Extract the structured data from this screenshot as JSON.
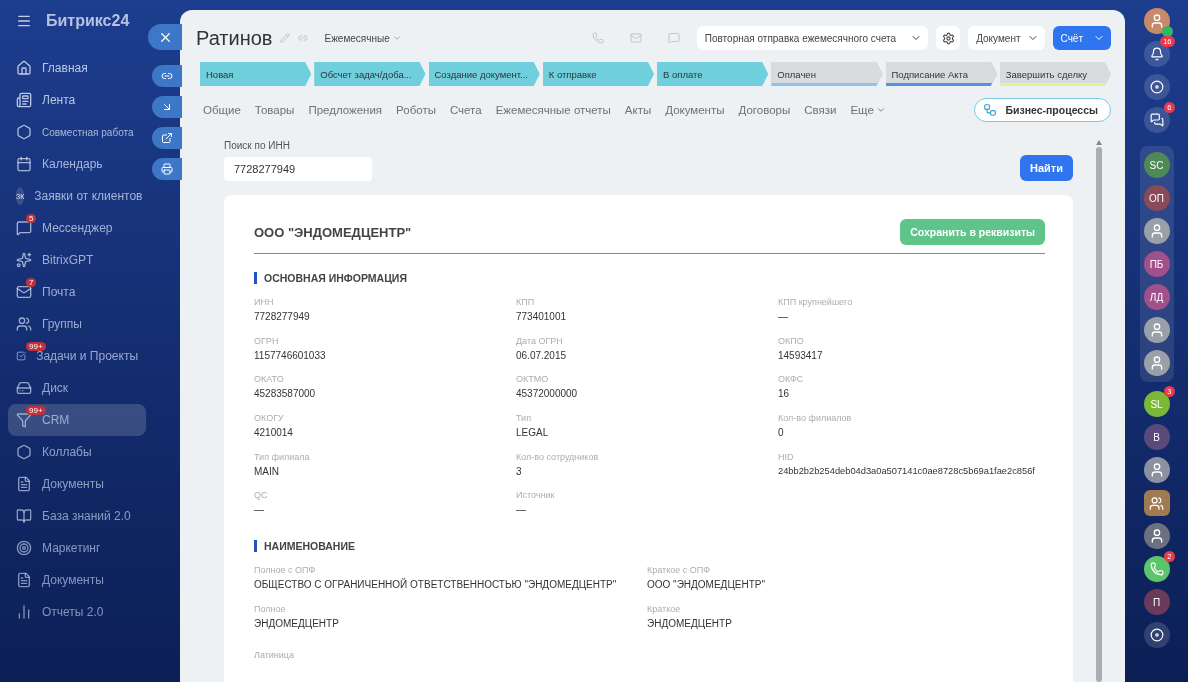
{
  "brand": {
    "name": "Битрикс24"
  },
  "sidebar": {
    "items": [
      {
        "label": "Главная",
        "selected": false
      },
      {
        "label": "Лента",
        "selected": false
      },
      {
        "label": "Совместная работа",
        "kind": "group",
        "selected": false
      },
      {
        "label": "Календарь",
        "selected": false
      },
      {
        "label": "Заявки от клиентов",
        "avatar": "ЗК",
        "selected": false
      },
      {
        "label": "Мессенджер",
        "badge": "5",
        "selected": false
      },
      {
        "label": "BitrixGPT",
        "selected": false
      },
      {
        "label": "Почта",
        "badge": "7",
        "selected": false
      },
      {
        "label": "Группы",
        "selected": false
      },
      {
        "label": "Задачи и Проекты",
        "badge": "99+",
        "selected": false
      },
      {
        "label": "Диск",
        "selected": false
      },
      {
        "label": "CRM",
        "badge": "99+",
        "selected": true
      },
      {
        "label": "Коллабы",
        "selected": false
      },
      {
        "label": "Документы",
        "selected": false
      },
      {
        "label": "База знаний 2.0",
        "selected": false
      },
      {
        "label": "Маркетинг",
        "selected": false
      },
      {
        "label": "Документы",
        "selected": false
      },
      {
        "label": "Отчеты 2.0",
        "selected": false
      }
    ]
  },
  "header": {
    "title": "Ратинов",
    "category": "Ежемесячные",
    "template_select": "Повторная отправка ежемесячного счета",
    "document_button": "Документ",
    "invoice_button": "Счёт"
  },
  "stages": [
    {
      "label": "Новая",
      "done": true,
      "color": "#6fcfdc"
    },
    {
      "label": "Обсчет задач/доба...",
      "done": true,
      "color": "#6fcfdc"
    },
    {
      "label": "Создание документ...",
      "done": true,
      "color": "#6fcfdc"
    },
    {
      "label": "К отправке",
      "done": true,
      "color": "#6fcfdc"
    },
    {
      "label": "В оплате",
      "done": true,
      "color": "#6fcfdc"
    },
    {
      "label": "Оплачен",
      "done": false,
      "color": "#8fc3ef"
    },
    {
      "label": "Подписание Акта",
      "done": false,
      "color": "#5b8fe0"
    },
    {
      "label": "Завершить сделку",
      "done": false,
      "color": "#e6ef9a"
    }
  ],
  "tabs": [
    "Общие",
    "Товары",
    "Предложения",
    "Роботы",
    "Счета",
    "Ежемесячные отчеты",
    "Акты",
    "Документы",
    "Договоры",
    "Связи",
    "Еще"
  ],
  "business_processes_button": "Бизнес-процессы",
  "search": {
    "label": "Поиск по ИНН",
    "value": "7728277949",
    "button": "Найти"
  },
  "company": {
    "name": "ООО \"ЭНДОМЕДЦЕНТР\"",
    "save_button": "Сохранить в реквизиты",
    "sections": [
      {
        "title": "ОСНОВНАЯ ИНФОРМАЦИЯ",
        "fields": [
          {
            "label": "ИНН",
            "value": "7728277949"
          },
          {
            "label": "КПП",
            "value": "773401001"
          },
          {
            "label": "КПП крупнейшего",
            "value": "—"
          },
          {
            "label": "ОГРН",
            "value": "1157746601033"
          },
          {
            "label": "Дата ОГРН",
            "value": "06.07.2015"
          },
          {
            "label": "ОКПО",
            "value": "14593417"
          },
          {
            "label": "ОКАТО",
            "value": "45283587000"
          },
          {
            "label": "ОКТМО",
            "value": "45372000000"
          },
          {
            "label": "ОКФС",
            "value": "16"
          },
          {
            "label": "ОКОГУ",
            "value": "4210014"
          },
          {
            "label": "Тип",
            "value": "LEGAL"
          },
          {
            "label": "Кол-во филиалов",
            "value": "0"
          },
          {
            "label": "Тип филиала",
            "value": "MAIN"
          },
          {
            "label": "Кол-во сотрудников",
            "value": "3"
          },
          {
            "label": "HID",
            "value": "24bb2b2b254deb04d3a0a507141c0ae8728c5b69a1fae2c856f"
          },
          {
            "label": "QC",
            "value": "—"
          },
          {
            "label": "Источник",
            "value": "—"
          }
        ]
      },
      {
        "title": "НАИМЕНОВАНИЕ",
        "fields": [
          {
            "label": "Полное с ОПФ",
            "value": "ОБЩЕСТВО С ОГРАНИЧЕННОЙ ОТВЕТСТВЕННОСТЬЮ \"ЭНДОМЕДЦЕНТР\""
          },
          {
            "label": "Краткое с ОПФ",
            "value": "ООО \"ЭНДОМЕДЦЕНТР\""
          },
          {
            "label": "Полное",
            "value": "ЭНДОМЕДЦЕНТР"
          },
          {
            "label": "Краткое",
            "value": "ЭНДОМЕДЦЕНТР"
          },
          {
            "label": "Латиница"
          }
        ]
      }
    ]
  },
  "right_bar": {
    "top": [
      {
        "kind": "photo",
        "color": "#c98a6a"
      },
      {
        "kind": "bell",
        "badge": "16"
      },
      {
        "kind": "swirl"
      },
      {
        "kind": "chat",
        "badge": "6"
      }
    ],
    "group": [
      {
        "kind": "initials",
        "text": "SC",
        "color": "#4e8a55"
      },
      {
        "kind": "initials",
        "text": "ОП",
        "color": "#8a4a5a"
      },
      {
        "kind": "photo",
        "color": "#9aa0a8"
      },
      {
        "kind": "initials",
        "text": "ПБ",
        "color": "#a0508a"
      },
      {
        "kind": "initials",
        "text": "ЛД",
        "color": "#a0508a"
      },
      {
        "kind": "photo",
        "color": "#9aa0a8"
      },
      {
        "kind": "photo",
        "color": "#9aa0a8"
      }
    ],
    "bottom": [
      {
        "kind": "initials",
        "text": "SL",
        "color": "#7bb83a",
        "badge": "3"
      },
      {
        "kind": "initials",
        "text": "В",
        "color": "#5a4a7a"
      },
      {
        "kind": "photo",
        "color": "#8a92a0"
      },
      {
        "kind": "team",
        "color": "#a07a50"
      },
      {
        "kind": "photo",
        "color": "#6a7280"
      },
      {
        "kind": "phone",
        "color": "#5cc46a",
        "badge": "2"
      },
      {
        "kind": "initials",
        "text": "П",
        "color": "#6a3a5a"
      },
      {
        "kind": "swirl"
      }
    ]
  }
}
